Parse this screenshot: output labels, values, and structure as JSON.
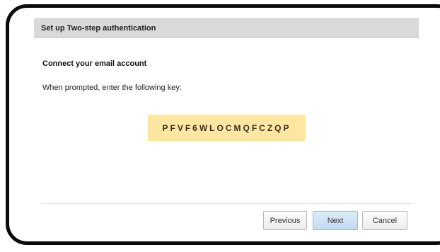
{
  "dialog": {
    "title": "Set up Two-step authentication",
    "heading": "Connect your email account",
    "instruction": "When prompted, enter the following key:",
    "key": "PFVF6WLOCMQFCZQP"
  },
  "buttons": {
    "previous": "Previous",
    "next": "Next",
    "cancel": "Cancel"
  },
  "colors": {
    "key_highlight": "#fde6a2",
    "titlebar": "#d9d9d9",
    "next_button": "#c5dbef"
  }
}
